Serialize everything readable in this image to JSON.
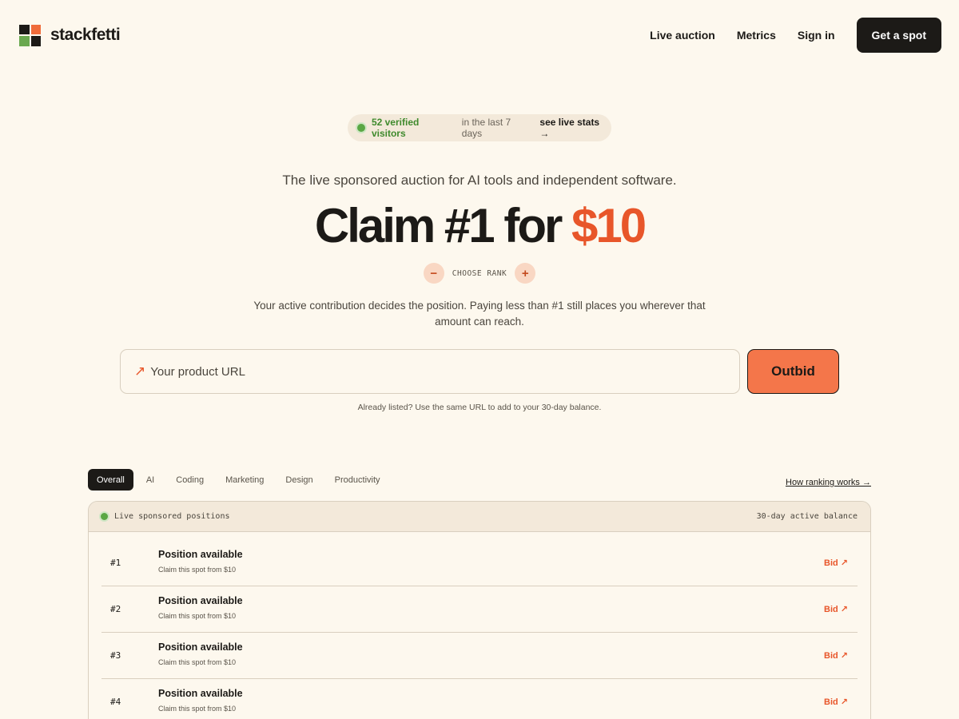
{
  "header": {
    "brand": "stackfetti",
    "nav": [
      "Live auction",
      "Metrics",
      "Sign in"
    ],
    "cta": "Get a spot"
  },
  "hero": {
    "visitors": "52 verified visitors",
    "period": "in the last 7 days",
    "stats_link": "see live stats →",
    "tagline": "The live sponsored auction for AI tools and independent software.",
    "headline_prefix": "Claim #1 for",
    "headline_price": "$10",
    "rank_minus": "−",
    "rank_label": "CHOOSE RANK",
    "rank_plus": "+",
    "description": "Your active contribution decides the position. Paying less than #1 still places you wherever that amount can reach.",
    "url_placeholder": "Your product URL",
    "url_icon": "↗",
    "outbid": "Outbid",
    "hint": "Already listed? Use the same URL to add to your 30-day balance."
  },
  "tabs": {
    "items": [
      "Overall",
      "AI",
      "Coding",
      "Marketing",
      "Design",
      "Productivity"
    ],
    "active": "Overall",
    "how_link": "How ranking works →"
  },
  "table": {
    "header_left": "Live sponsored positions",
    "header_right": "30-day active balance",
    "rows": [
      {
        "rank": "#1",
        "title": "Position available",
        "subtitle": "Claim this spot from $10",
        "action": "Bid ↗"
      },
      {
        "rank": "#2",
        "title": "Position available",
        "subtitle": "Claim this spot from $10",
        "action": "Bid ↗"
      },
      {
        "rank": "#3",
        "title": "Position available",
        "subtitle": "Claim this spot from $10",
        "action": "Bid ↗"
      },
      {
        "rank": "#4",
        "title": "Position available",
        "subtitle": "Claim this spot from $10",
        "action": "Bid ↗"
      }
    ]
  },
  "colors": {
    "background": "#fdf8ee",
    "accent": "#e8562a",
    "button_orange": "#f4764a",
    "dark": "#1c1a17",
    "green": "#5aa744"
  },
  "icons": {
    "logo": "stackfetti-logo-icon",
    "live_dot": "live-dot-icon",
    "url": "arrow-up-right-icon"
  }
}
